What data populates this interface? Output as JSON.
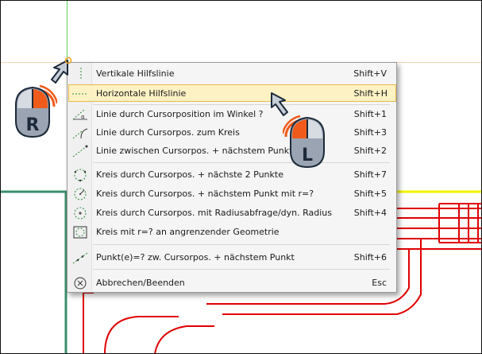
{
  "menu": {
    "items": [
      {
        "label": "Vertikale Hilfslinie",
        "shortcut": "Shift+V",
        "icon": "vertical-guide-icon"
      },
      {
        "label": "Horizontale Hilfslinie",
        "shortcut": "Shift+H",
        "icon": "horizontal-guide-icon",
        "selected": true
      },
      {
        "label": "Linie durch Cursorposition im Winkel ?",
        "shortcut": "Shift+1",
        "icon": "angle-line-icon"
      },
      {
        "label": "Linie durch Cursorpos. zum Kreis",
        "shortcut": "Shift+3",
        "icon": "line-to-circle-icon"
      },
      {
        "label": "Linie zwischen Cursorpos. + nächstem Punkt",
        "shortcut": "Shift+2",
        "icon": "line-to-point-icon"
      },
      {
        "label": "Kreis durch Cursorpos. + nächste 2 Punkte",
        "shortcut": "Shift+7",
        "icon": "circle-three-points-icon"
      },
      {
        "label": "Kreis durch Cursorpos. + nächstem Punkt mit r=?",
        "shortcut": "Shift+5",
        "icon": "circle-point-radius-icon"
      },
      {
        "label": "Kreis durch Cursorpos. mit Radiusabfrage/dyn. Radius",
        "shortcut": "Shift+4",
        "icon": "circle-dynamic-radius-icon"
      },
      {
        "label": "Kreis mit r=? an angrenzender Geometrie",
        "shortcut": "",
        "icon": "circle-tangent-icon"
      },
      {
        "label": "Punkt(e)=?  zw. Cursorpos. + nächstem Punkt",
        "shortcut": "Shift+6",
        "icon": "points-between-icon"
      },
      {
        "label": "Abbrechen/Beenden",
        "shortcut": "Esc",
        "icon": "cancel-icon"
      }
    ]
  },
  "badges": {
    "right": {
      "letter": "R"
    },
    "left": {
      "letter": "L"
    }
  },
  "colors": {
    "highlight_bg": "#fdf2c4",
    "highlight_border": "#e8b94a",
    "red_line": "#e00000",
    "yellow_line": "#f2f200",
    "green_line": "#3a8f6c",
    "mouse_orange": "#f05a1a"
  }
}
